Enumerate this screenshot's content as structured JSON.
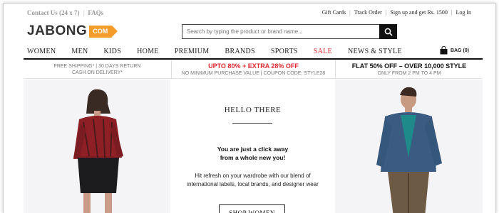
{
  "utility": {
    "contact": "Contact Us (24 x 7)",
    "faqs": "FAQs",
    "links": [
      "Gift Cards",
      "Track Order",
      "Sign up and get Rs. 1500",
      "Log In"
    ]
  },
  "logo": {
    "text": "JABONG",
    "badge": "COM"
  },
  "search": {
    "placeholder": "Search by typing the product or brand name..."
  },
  "nav": {
    "items": [
      "WOMEN",
      "MEN",
      "KIDS",
      "HOME",
      "PREMIUM",
      "BRANDS",
      "SPORTS",
      "SALE",
      "NEWS & STYLE"
    ],
    "bag_label": "BAG (0)"
  },
  "promo": {
    "col1": {
      "line1": "FREE SHIPPING* | 30 DAYS RETURN",
      "line2": "CASH ON DELIVERY*"
    },
    "col2": {
      "headline": "UPTO 80% + EXTRA 28% OFF",
      "sub": "NO MINIMUM PURCHASE VALUE | COUPON CODE: STYLE28"
    },
    "col3": {
      "headline": "FLAT 50% OFF – OVER 10,000 STYLE",
      "sub": "ONLY FROM 2 PM TO 4 PM"
    }
  },
  "banner": {
    "hello": "HELLO THERE",
    "tagline1": "You are just a click away",
    "tagline2": "from a whole new you!",
    "desc1": "Hit refresh on your wardrobe with our blend of",
    "desc2": "international labels, local brands, and designer wear",
    "cta": "SHOP WOMEN"
  },
  "colors": {
    "accent": "#f39c2a",
    "sale": "#e0282f",
    "dark": "#111111"
  }
}
